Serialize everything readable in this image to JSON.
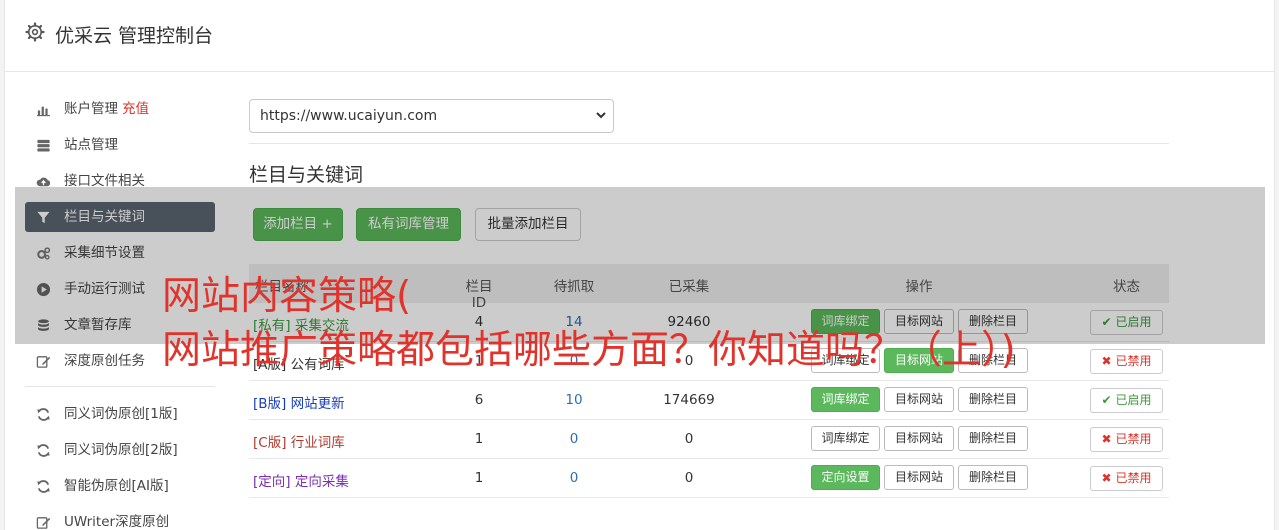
{
  "header": {
    "title": "优采云 管理控制台"
  },
  "sidebar": {
    "items": [
      {
        "label": "账户管理",
        "extra": "充值",
        "icon": "bar-chart-icon"
      },
      {
        "label": "站点管理",
        "icon": "server-icon"
      },
      {
        "label": "接口文件相关",
        "icon": "cloud-upload-icon"
      },
      {
        "label": "栏目与关键词",
        "icon": "filter-icon",
        "active": true
      },
      {
        "label": "采集细节设置",
        "icon": "gears-icon"
      },
      {
        "label": "手动运行测试",
        "icon": "play-icon"
      },
      {
        "label": "文章暂存库",
        "icon": "database-icon"
      },
      {
        "label": "深度原创任务",
        "icon": "edit-icon"
      }
    ],
    "items2": [
      {
        "label": "同义词伪原创[1版]",
        "icon": "refresh-icon"
      },
      {
        "label": "同义词伪原创[2版]",
        "icon": "refresh-icon"
      },
      {
        "label": "智能伪原创[AI版]",
        "icon": "refresh-icon"
      },
      {
        "label": "UWriter深度原创",
        "icon": "edit-icon"
      }
    ]
  },
  "main": {
    "site_select": "https://www.ucaiyun.com",
    "section_title": "栏目与关键词",
    "buttons": {
      "add": "添加栏目 +",
      "private": "私有词库管理",
      "batch": "批量添加栏目"
    }
  },
  "table": {
    "headers": {
      "name": "栏目名称",
      "id": "栏目ID",
      "pending": "待抓取",
      "collected": "已采集",
      "ops": "操作",
      "status": "状态"
    },
    "rows": [
      {
        "tag": "[私有]",
        "name": "采集交流",
        "id": "4",
        "pending": "14",
        "collected": "92460",
        "op1": "词库绑定",
        "op2": "目标网站",
        "op3": "删除栏目",
        "status": "已启用",
        "color": "#3c9a3c",
        "on": true,
        "op1_green": true,
        "op2_green": false
      },
      {
        "tag": "[A版]",
        "name": "公有词库",
        "id": "1",
        "pending": "0",
        "collected": "0",
        "op1": "词库绑定",
        "op2": "目标网站",
        "op3": "删除栏目",
        "status": "已禁用",
        "color": "#333333",
        "on": false,
        "op1_green": false,
        "op2_green": true
      },
      {
        "tag": "[B版]",
        "name": "网站更新",
        "id": "6",
        "pending": "10",
        "collected": "174669",
        "op1": "词库绑定",
        "op2": "目标网站",
        "op3": "删除栏目",
        "status": "已启用",
        "color": "#1a3fb8",
        "on": true,
        "op1_green": true,
        "op2_green": false
      },
      {
        "tag": "[C版]",
        "name": "行业词库",
        "id": "1",
        "pending": "0",
        "collected": "0",
        "op1": "词库绑定",
        "op2": "目标网站",
        "op3": "删除栏目",
        "status": "已禁用",
        "color": "#b03a2e",
        "on": false,
        "op1_green": false,
        "op2_green": false
      },
      {
        "tag": "[定向]",
        "name": "定向采集",
        "id": "1",
        "pending": "0",
        "collected": "0",
        "op1": "定向设置",
        "op2": "目标网站",
        "op3": "删除栏目",
        "status": "已禁用",
        "color": "#7b2fb0",
        "on": false,
        "op1_green": true,
        "op2_green": false
      }
    ]
  },
  "overlay": {
    "line1": "网站内容策略(",
    "line2": "网站推广策略都包括哪些方面？你知道吗？（上）)"
  }
}
